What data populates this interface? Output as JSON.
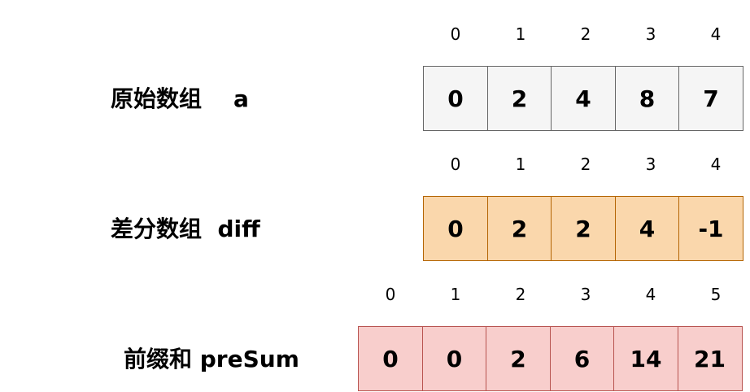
{
  "original": {
    "label": "原始数组    a",
    "indices": [
      "0",
      "1",
      "2",
      "3",
      "4"
    ],
    "values": [
      "0",
      "2",
      "4",
      "8",
      "7"
    ],
    "fill": "#f5f5f5",
    "stroke": "#666666"
  },
  "diff": {
    "label": "差分数组  diff",
    "indices": [
      "0",
      "1",
      "2",
      "3",
      "4"
    ],
    "values": [
      "0",
      "2",
      "2",
      "4",
      "-1"
    ],
    "fill": "#fad7ac",
    "stroke": "#b46504"
  },
  "presum": {
    "label": "前缀和 preSum",
    "indices": [
      "0",
      "1",
      "2",
      "3",
      "4",
      "5"
    ],
    "values": [
      "0",
      "0",
      "2",
      "6",
      "14",
      "21"
    ],
    "fill": "#f8cecc",
    "stroke": "#b85450"
  }
}
